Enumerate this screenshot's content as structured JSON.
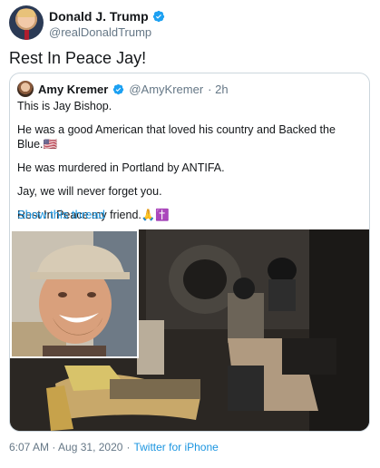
{
  "tweet": {
    "display_name": "Donald J. Trump",
    "handle": "@realDonaldTrump",
    "text": "Rest In Peace Jay!",
    "timestamp": "6:07 AM · Aug 31, 2020",
    "separator": "·",
    "source": "Twitter for iPhone"
  },
  "quote": {
    "display_name": "Amy Kremer",
    "handle": "@AmyKremer",
    "age": "· 2h",
    "lines": [
      "This is Jay Bishop.",
      "He was a good American that loved his country and Backed the Blue.🇺🇸",
      "He was murdered in Portland by ANTIFA.",
      "Jay, we will never forget you.",
      "Rest In Peace my friend.🙏✝️"
    ],
    "show_thread": "Show this thread"
  },
  "colors": {
    "verified_blue": "#1da1f2",
    "link_blue": "#1b95e0",
    "secondary_text": "#657786",
    "border": "#ccd6dd"
  },
  "icons": {
    "verified": "verified-badge-icon"
  }
}
